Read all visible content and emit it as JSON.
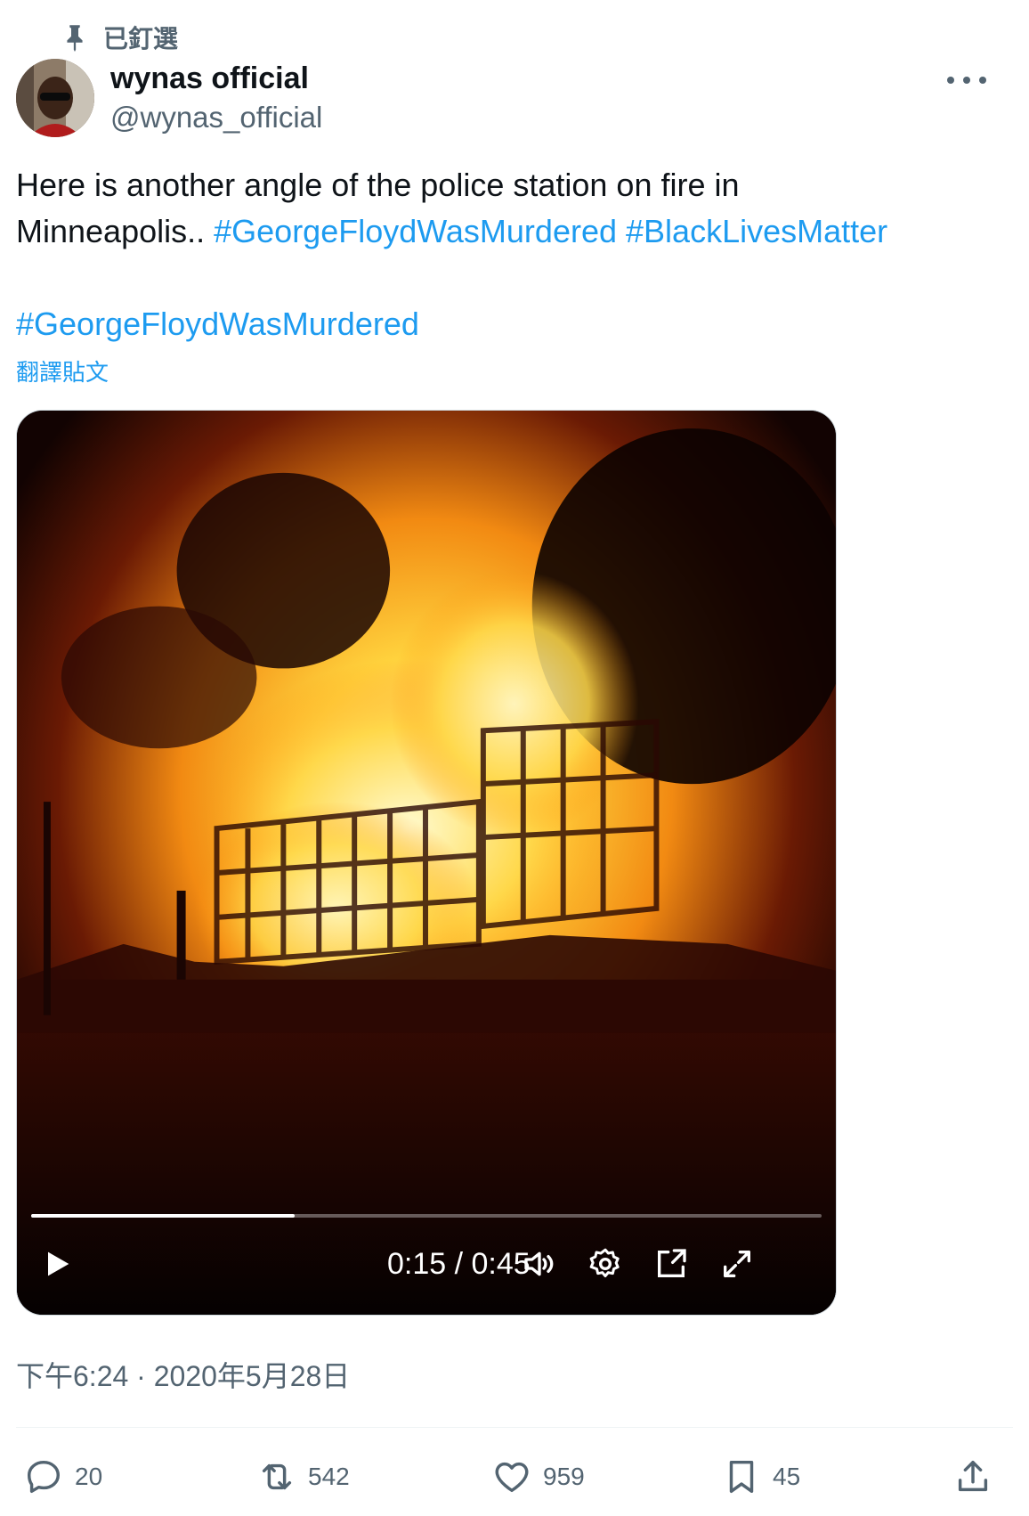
{
  "pinned": {
    "label": "已釘選",
    "icon": "pin-icon"
  },
  "author": {
    "display_name": "wynas official",
    "handle": "@wynas_official"
  },
  "tweet": {
    "text_plain": "Here is another angle of the police station on fire in",
    "text_plain2": "Minneapolis.. ",
    "hashtag1": "#GeorgeFloydWasMurdered",
    "hashtag2": "#BlackLivesMatter",
    "hashtag3": "#GeorgeFloydWasMurdered",
    "translate_label": "翻譯貼文"
  },
  "video": {
    "current_time": "0:15",
    "duration": "0:45",
    "time_display": "0:15 / 0:45",
    "progress_fraction": 0.333
  },
  "timestamp": "下午6:24 · 2020年5月28日",
  "actions": {
    "replies": "20",
    "reposts": "542",
    "likes": "959",
    "bookmarks": "45"
  },
  "colors": {
    "link": "#1d9bf0",
    "secondary": "#536471",
    "text": "#0f1419"
  }
}
